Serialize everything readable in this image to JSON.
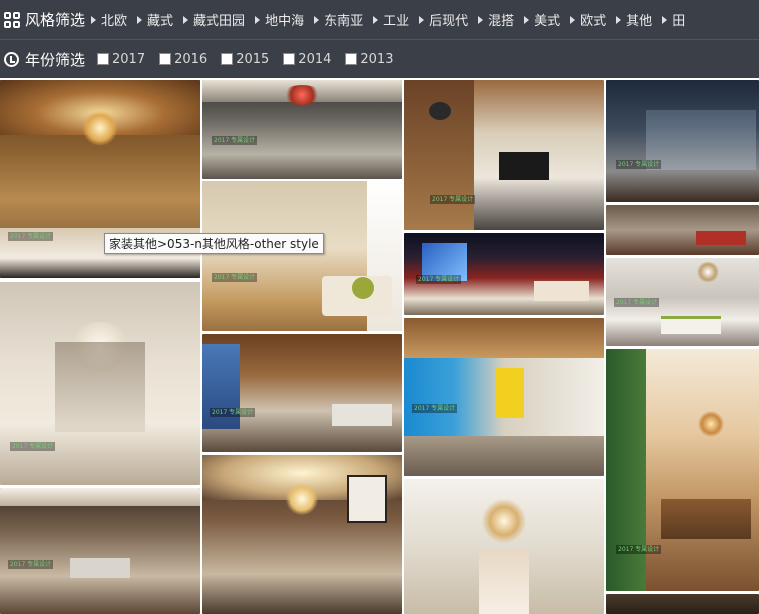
{
  "style_filter": {
    "title": "风格筛选",
    "items": [
      "北欧",
      "藏式",
      "藏式田园",
      "地中海",
      "东南亚",
      "工业",
      "后现代",
      "混搭",
      "美式",
      "欧式",
      "其他",
      "田"
    ]
  },
  "year_filter": {
    "title": "年份筛选",
    "years": [
      "2017",
      "2016",
      "2015",
      "2014",
      "2013"
    ]
  },
  "tooltip": "家装其他>053-n其他风格-other style",
  "watermark": "2017 专属设计"
}
